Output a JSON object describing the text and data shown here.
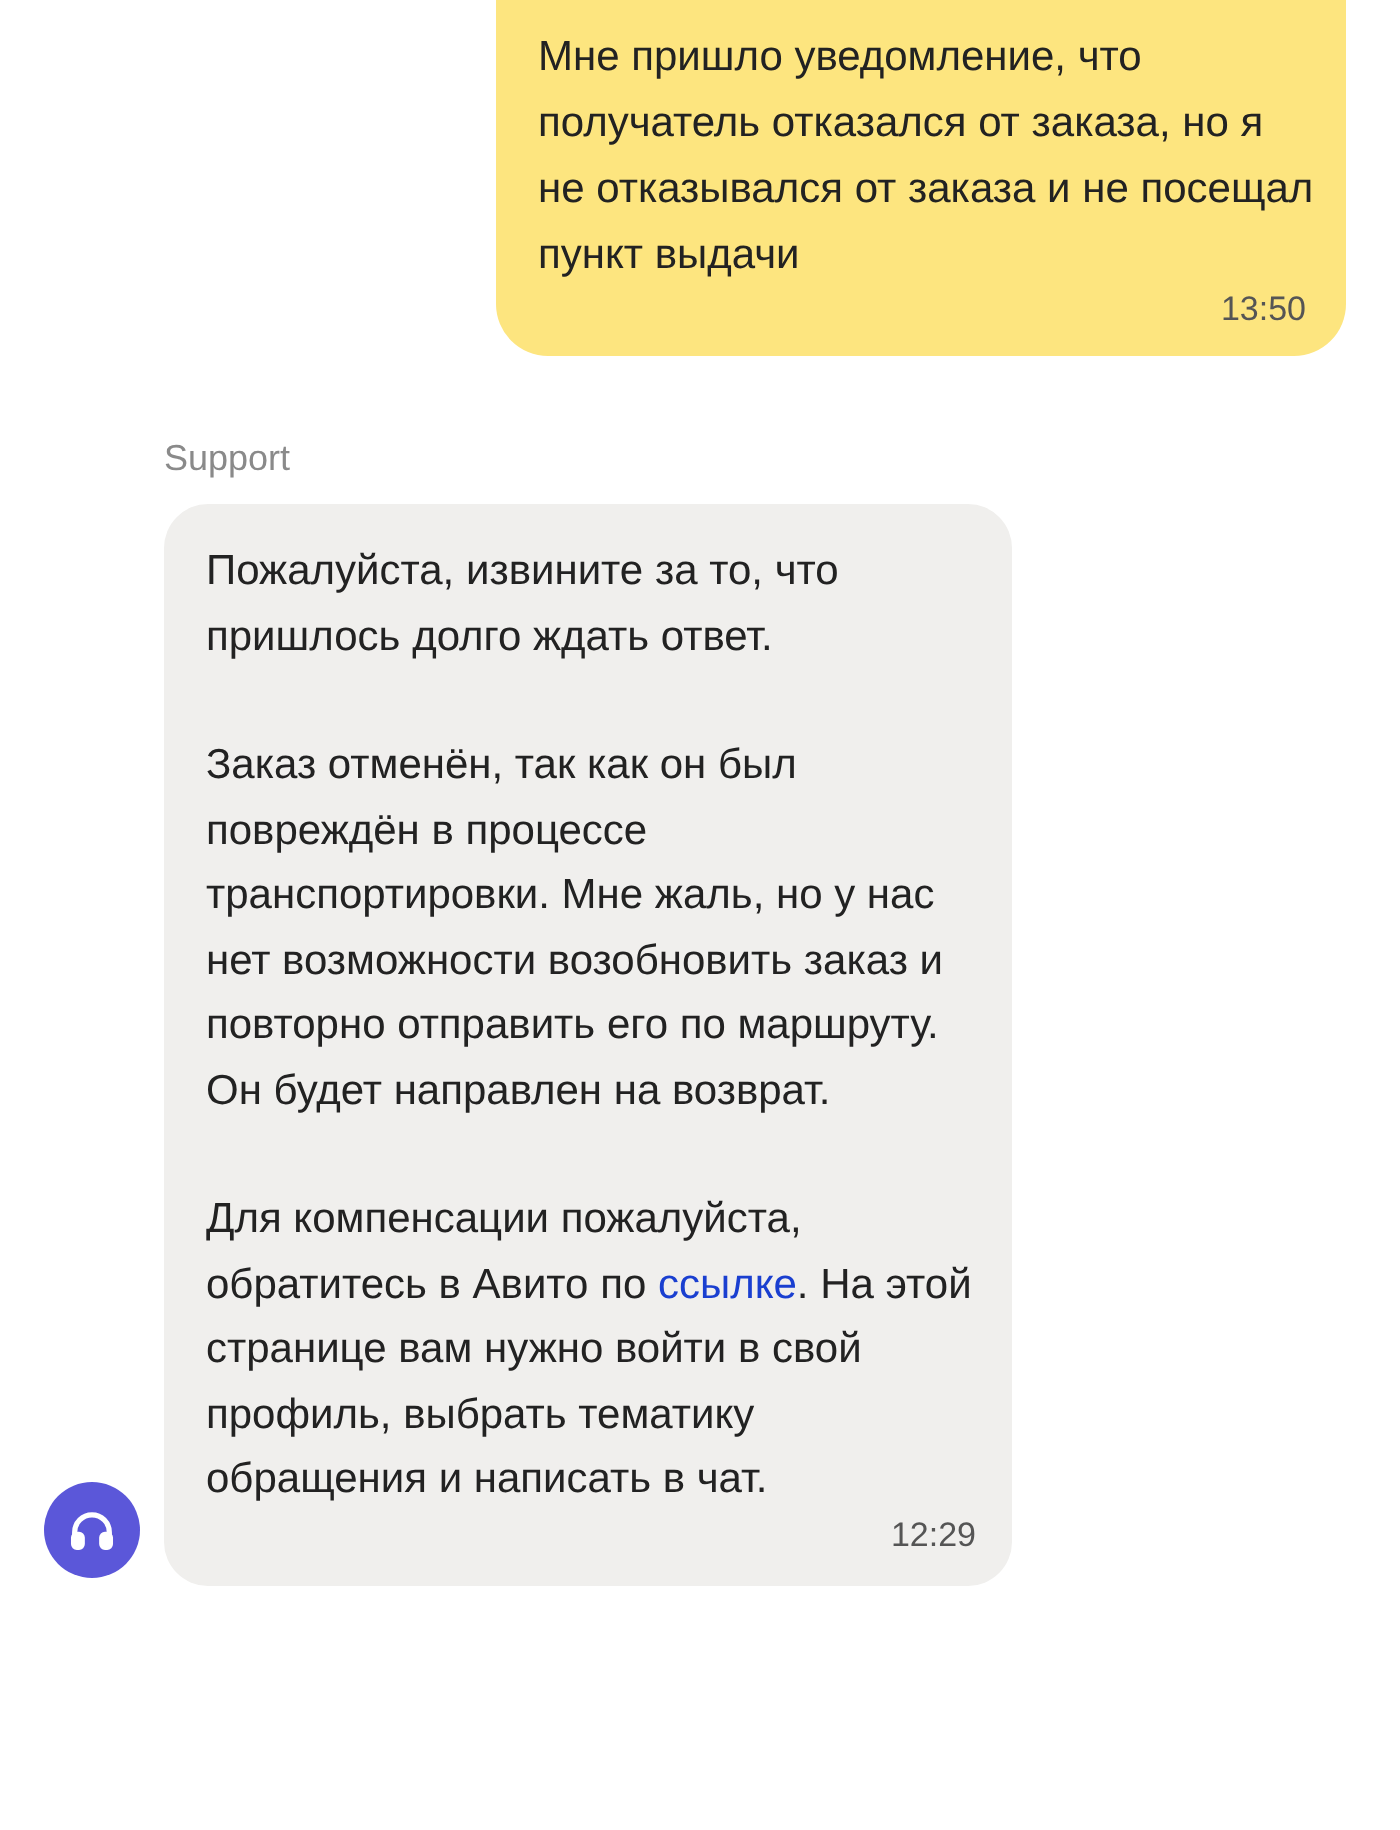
{
  "messages": [
    {
      "kind": "outgoing",
      "paragraphs": [
        {
          "text": "Мне пришло уведомление, что получатель отказался от заказа, но я не отказывался от заказа и не посещал пункт выдачи"
        }
      ],
      "time": "13:50"
    },
    {
      "kind": "incoming",
      "sender": "Support",
      "paragraphs": [
        {
          "text": "Пожалуйста, извините за то, что пришлось долго ждать ответ."
        },
        {
          "text": "Заказ отменён, так как он был повреждён в процессе транспортировки. Мне жаль, но у нас нет возможности возобновить заказ и повторно отправить его по маршруту. Он будет направлен на возврат."
        },
        {
          "text": "Для компенсации пожалуйста, обратитесь в Авито по ",
          "link": "ссылке",
          "after": ". На этой странице вам нужно войти в свой профиль, выбрать тематику обращения и написать в чат."
        }
      ],
      "time": "12:29"
    }
  ]
}
